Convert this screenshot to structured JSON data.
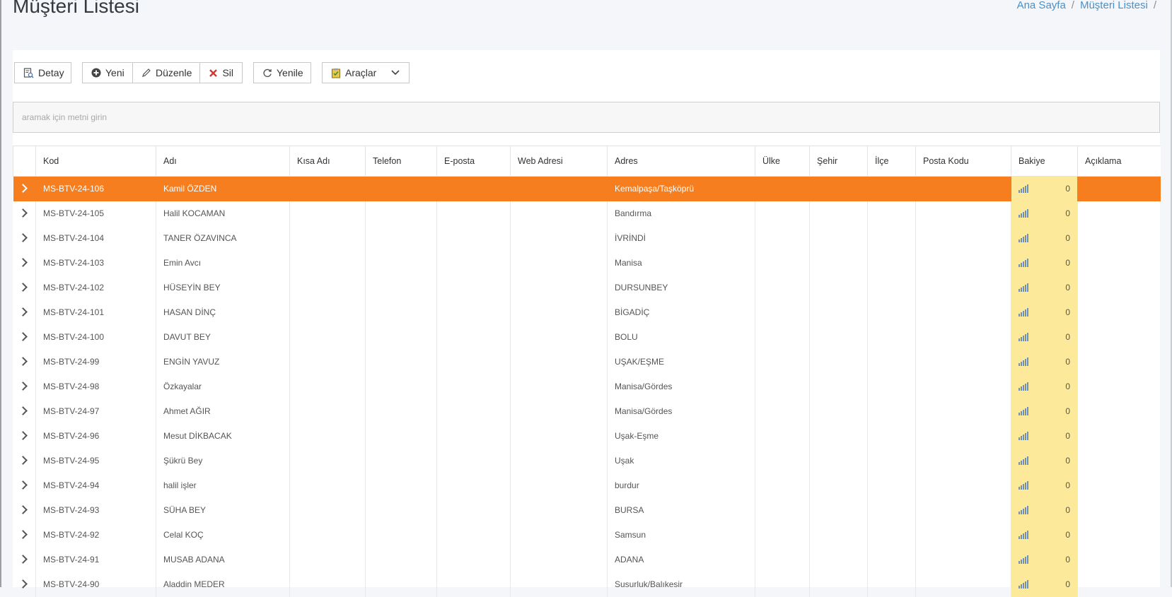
{
  "page": {
    "title": "Müşteri Listesi",
    "breadcrumb": {
      "home": "Ana Sayfa",
      "current": "Müşteri Listesi",
      "separator": "/"
    }
  },
  "toolbar": {
    "detay": "Detay",
    "yeni": "Yeni",
    "duzenle": "Düzenle",
    "sil": "Sil",
    "yenile": "Yenile",
    "araclar": "Araçlar"
  },
  "search": {
    "placeholder": "aramak için metni girin",
    "value": ""
  },
  "grid": {
    "columns": [
      "Kod",
      "Adı",
      "Kısa Adı",
      "Telefon",
      "E-posta",
      "Web Adresi",
      "Adres",
      "Ülke",
      "Şehir",
      "İlçe",
      "Posta Kodu",
      "Bakiye",
      "Açıklama"
    ],
    "selected_row": 0,
    "rows": [
      {
        "kod": "MS-BTV-24-106",
        "adi": "Kamil ÖZDEN",
        "adres": "Kemalpaşa/Taşköprü",
        "bakiye": "0"
      },
      {
        "kod": "MS-BTV-24-105",
        "adi": "Halil KOCAMAN",
        "adres": "Bandırma",
        "bakiye": "0"
      },
      {
        "kod": "MS-BTV-24-104",
        "adi": "TANER ÖZAVINCA",
        "adres": "İVRİNDİ",
        "bakiye": "0"
      },
      {
        "kod": "MS-BTV-24-103",
        "adi": "Emin Avcı",
        "adres": "Manisa",
        "bakiye": "0"
      },
      {
        "kod": "MS-BTV-24-102",
        "adi": "HÜSEYİN BEY",
        "adres": "DURSUNBEY",
        "bakiye": "0"
      },
      {
        "kod": "MS-BTV-24-101",
        "adi": "HASAN DİNÇ",
        "adres": "BİGADİÇ",
        "bakiye": "0"
      },
      {
        "kod": "MS-BTV-24-100",
        "adi": "DAVUT BEY",
        "adres": "BOLU",
        "bakiye": "0"
      },
      {
        "kod": "MS-BTV-24-99",
        "adi": "ENGİN YAVUZ",
        "adres": "UŞAK/EŞME",
        "bakiye": "0"
      },
      {
        "kod": "MS-BTV-24-98",
        "adi": "Özkayalar",
        "adres": "Manisa/Gördes",
        "bakiye": "0"
      },
      {
        "kod": "MS-BTV-24-97",
        "adi": "Ahmet AĞIR",
        "adres": "Manisa/Gördes",
        "bakiye": "0"
      },
      {
        "kod": "MS-BTV-24-96",
        "adi": "Mesut DİKBACAK",
        "adres": "Uşak-Eşme",
        "bakiye": "0"
      },
      {
        "kod": "MS-BTV-24-95",
        "adi": "Şükrü Bey",
        "adres": "Uşak",
        "bakiye": "0"
      },
      {
        "kod": "MS-BTV-24-94",
        "adi": "halil işler",
        "adres": "burdur",
        "bakiye": "0"
      },
      {
        "kod": "MS-BTV-24-93",
        "adi": "SÜHA BEY",
        "adres": "BURSA",
        "bakiye": "0"
      },
      {
        "kod": "MS-BTV-24-92",
        "adi": "Celal KOÇ",
        "adres": "Samsun",
        "bakiye": "0"
      },
      {
        "kod": "MS-BTV-24-91",
        "adi": "MUSAB ADANA",
        "adres": "ADANA",
        "bakiye": "0"
      },
      {
        "kod": "MS-BTV-24-90",
        "adi": "Aladdin MEDER",
        "adres": "Susurluk/Balıkesir",
        "bakiye": "0"
      }
    ]
  },
  "colors": {
    "accent": "#f67e1f",
    "bakiye_bg": "#fde99a",
    "link": "#4a90c8"
  },
  "icons": {
    "detay": "report-search-icon",
    "yeni": "plus-circle-icon",
    "duzenle": "pencil-icon",
    "sil": "x-icon",
    "yenile": "refresh-icon",
    "araclar": "clipboard-icon",
    "araclar_dropdown": "chevron-down-icon",
    "row_expand": "chevron-right-icon",
    "bakiye": "bar-chart-icon"
  }
}
